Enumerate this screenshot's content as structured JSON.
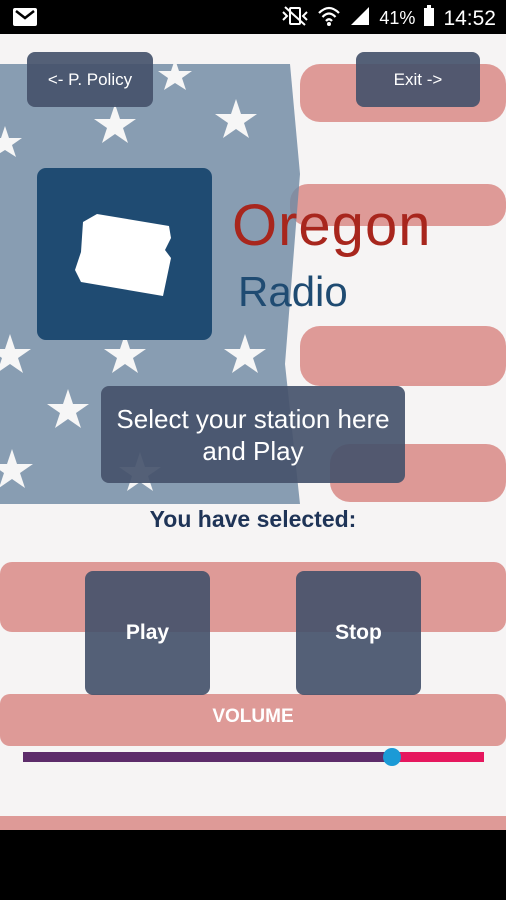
{
  "status_bar": {
    "battery": "41%",
    "time": "14:52",
    "icons": [
      "gmail-icon",
      "mute-vibrate-icon",
      "wifi-icon",
      "signal-icon",
      "battery-icon"
    ]
  },
  "header": {
    "policy_label": "<- P. Policy",
    "exit_label": "Exit ->"
  },
  "logo": {
    "title_line1": "Oregon",
    "title_line2": "Radio",
    "icon": "oregon-state-icon"
  },
  "station": {
    "select_label": "Select your station here and Play",
    "selected_text": "You have selected:"
  },
  "controls": {
    "play_label": "Play",
    "stop_label": "Stop"
  },
  "volume": {
    "label": "VOLUME",
    "level": 0.8
  },
  "colors": {
    "accent_red": "#a8261d",
    "navy": "#1f4b72",
    "button_gray": "#45536b",
    "slider_pink": "#e6175e",
    "slider_purple": "#5d2c6a",
    "slider_thumb": "#1b9ad6"
  }
}
